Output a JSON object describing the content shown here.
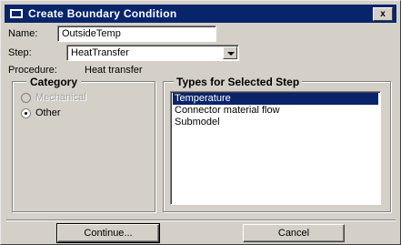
{
  "window": {
    "title": "Create Boundary Condition",
    "close_label": "x"
  },
  "form": {
    "name_label": "Name:",
    "name_value": "OutsideTemp",
    "step_label": "Step:",
    "step_value": "HeatTransfer",
    "procedure_label": "Procedure:",
    "procedure_value": "Heat transfer"
  },
  "category": {
    "title": "Category",
    "options": [
      {
        "label": "Mechanical",
        "checked": false,
        "enabled": false
      },
      {
        "label": "Other",
        "checked": true,
        "enabled": true
      }
    ]
  },
  "types": {
    "title": "Types for Selected Step",
    "items": [
      {
        "label": "Temperature",
        "selected": true
      },
      {
        "label": "Connector material flow",
        "selected": false
      },
      {
        "label": "Submodel",
        "selected": false
      }
    ]
  },
  "buttons": {
    "continue_label": "Continue...",
    "cancel_label": "Cancel"
  }
}
